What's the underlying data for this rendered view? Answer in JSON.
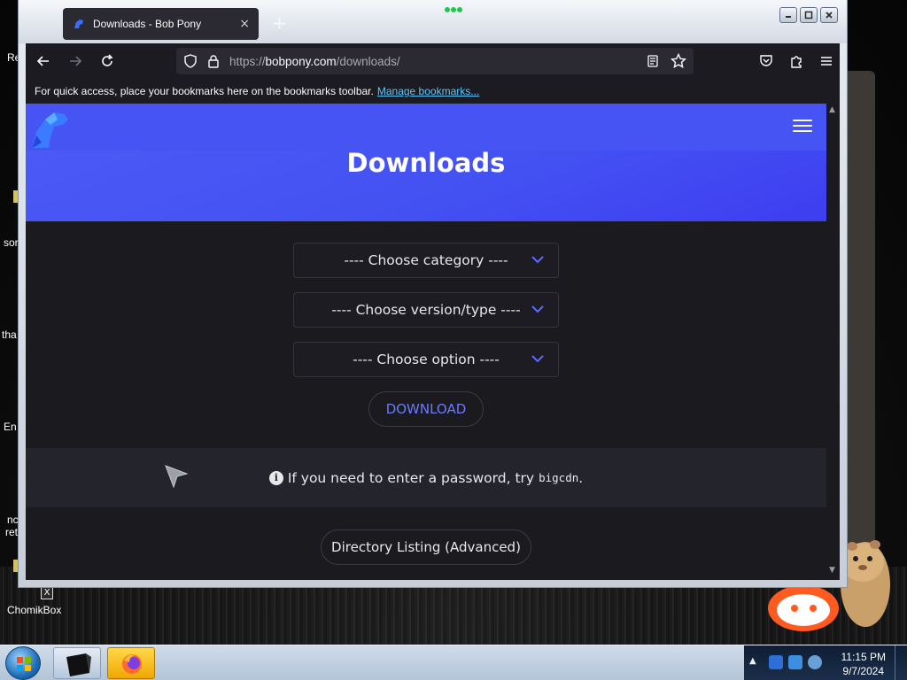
{
  "browser": {
    "tab_title": "Downloads - Bob Pony",
    "tab_close": "×",
    "new_tab": "+",
    "url_scheme": "https://",
    "url_host": "bobpony.com",
    "url_path": "/downloads/",
    "bookmarks_message": "For quick access, place your bookmarks here on the bookmarks toolbar.",
    "bookmarks_link": "Manage bookmarks...",
    "window_controls": [
      "minimize",
      "maximize",
      "close"
    ]
  },
  "page": {
    "title": "Downloads",
    "selects": [
      {
        "label": "---- Choose category ----"
      },
      {
        "label": "---- Choose version/type ----"
      },
      {
        "label": "---- Choose option ----"
      }
    ],
    "download_label": "DOWNLOAD",
    "notice_text": "If you need to enter a password, try",
    "notice_code": "bigcdn",
    "notice_end": ".",
    "dirlist_label": "Directory Listing (Advanced)"
  },
  "desktop": {
    "icons": [
      {
        "label": "Re"
      },
      {
        "label": "sor"
      },
      {
        "label": "tha"
      },
      {
        "label": "En"
      },
      {
        "label": "nc"
      },
      {
        "label": "ret"
      },
      {
        "label": "ChomikBox"
      }
    ]
  },
  "taskbar": {
    "time": "11:15 PM",
    "date": "9/7/2024"
  },
  "colors": {
    "brand": "#4754f4",
    "accent_link": "#6a7bff",
    "bookmark_link": "#5ac8fa"
  }
}
